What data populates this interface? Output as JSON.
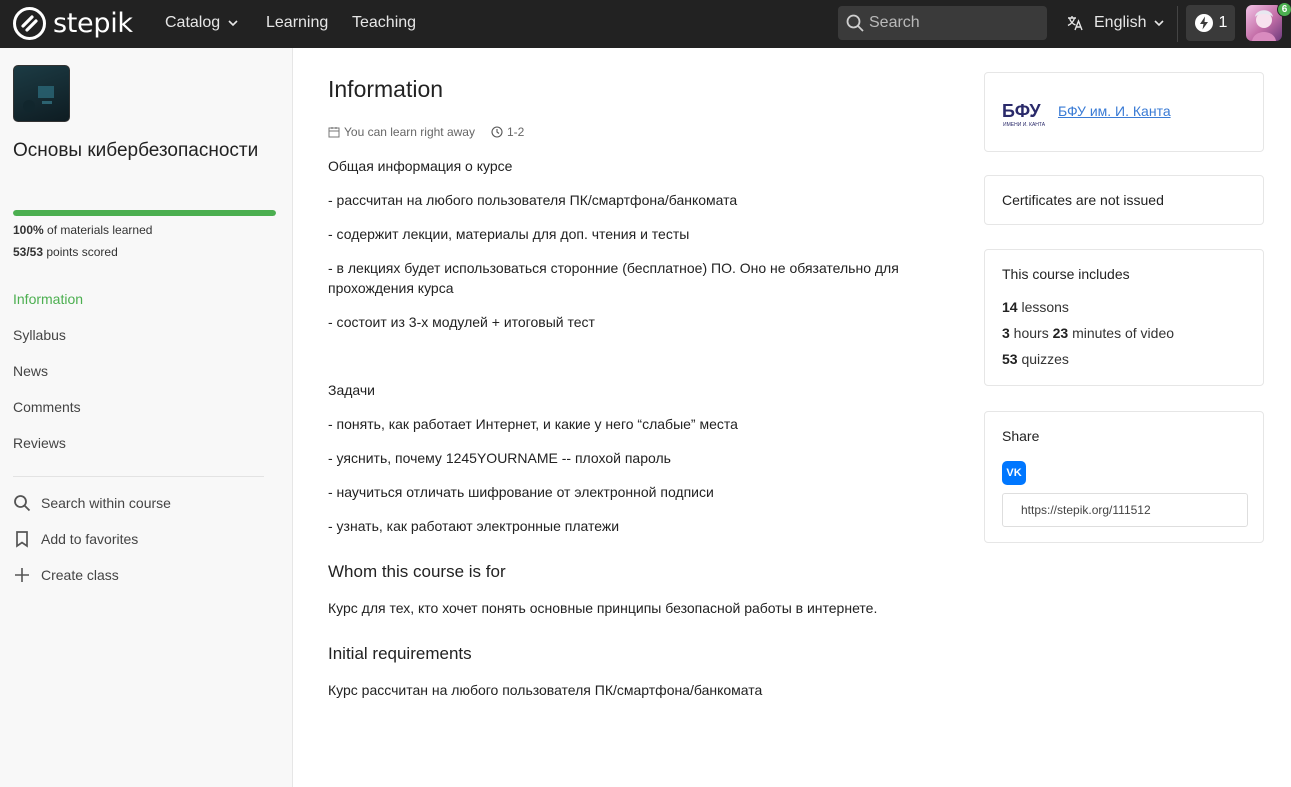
{
  "header": {
    "brand": "stepik",
    "nav": {
      "catalog": "Catalog",
      "learning": "Learning",
      "teaching": "Teaching"
    },
    "search_placeholder": "Search",
    "language": "English",
    "streak_count": "1",
    "avatar_badge": "6"
  },
  "sidebar": {
    "course_title": "Основы кибербезопасности",
    "progress_percent": 100,
    "progress_pct_text": "100%",
    "progress_text": " of materials learned",
    "points_value": "53/53",
    "points_text": " points scored",
    "nav": [
      "Information",
      "Syllabus",
      "News",
      "Comments",
      "Reviews"
    ],
    "actions": {
      "search": "Search within course",
      "favorites": "Add to favorites",
      "create_class": "Create class"
    }
  },
  "main": {
    "title": "Information",
    "meta": {
      "start": "You can learn right away",
      "hours": "1-2"
    },
    "paragraphs": [
      "Общая информация о курсе",
      "- рассчитан на любого пользователя ПК/смартфона/банкомата",
      "- содержит лекции, материалы для доп. чтения и тесты",
      "- в лекциях будет использоваться сторонние (бесплатное) ПО. Оно не обязательно для прохождения курса",
      "- состоит из 3-х модулей + итоговый тест",
      "Задачи",
      "- понять, как работает Интернет, и какие у него “слабые” места",
      "- уяснить, почему 1245YOURNAME -- плохой пароль",
      "- научиться отличать шифрование от электронной подписи",
      "- узнать, как работают электронные платежи"
    ],
    "audience_heading": "Whom this course is for",
    "audience_text": "Курс для тех, кто хочет понять основные принципы безопасной работы в интернете.",
    "requirements_heading": "Initial requirements",
    "requirements_text": "Курс рассчитан на любого пользователя ПК/смартфона/банкомата"
  },
  "right": {
    "institution_logo_text": "БФУ",
    "institution_logo_subtext": "ИМЕНИ И. КАНТА",
    "institution": "БФУ им. И. Канта",
    "certificates": "Certificates are not issued",
    "includes_heading": "This course includes",
    "lessons_num": "14",
    "lessons_text": " lessons",
    "hours_num": "3",
    "hours_text": " hours ",
    "minutes_num": "23",
    "minutes_text": " minutes of video",
    "quizzes_num": "53",
    "quizzes_text": " quizzes",
    "share_heading": "Share",
    "share_vk_label": "VK",
    "share_url": "https://stepik.org/111512"
  },
  "colors": {
    "accent": "#4caf50",
    "topbar": "#222222",
    "link": "#3a7bd5",
    "vk": "#0077ff"
  }
}
